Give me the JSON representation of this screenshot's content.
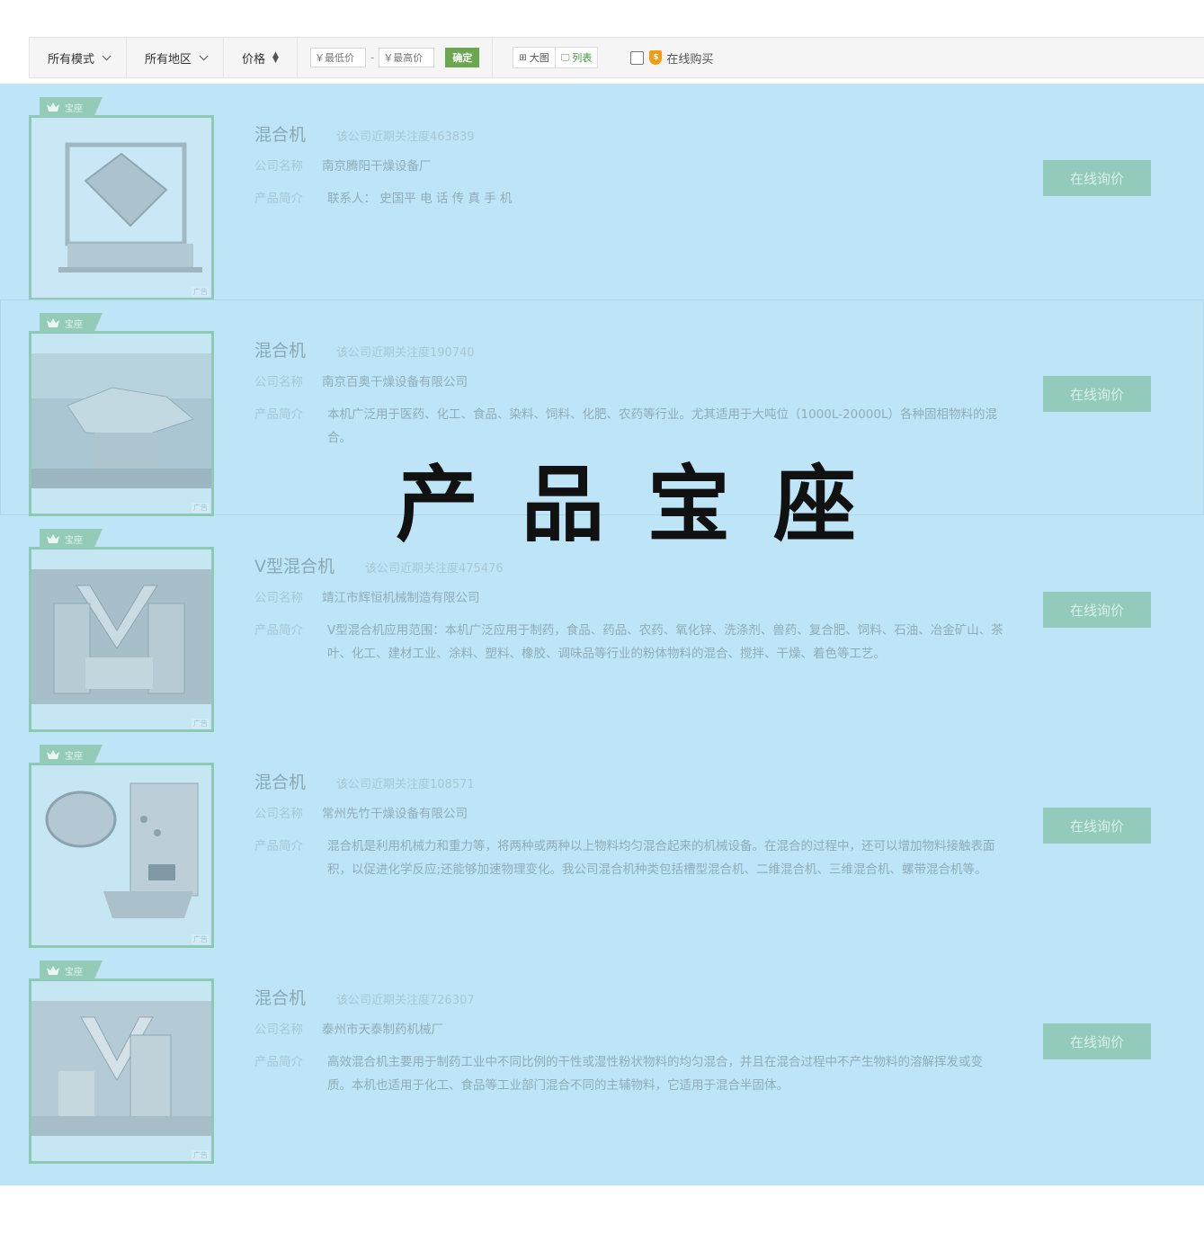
{
  "filter": {
    "mode_label": "所有模式",
    "region_label": "所有地区",
    "price_label": "价格",
    "min_price_placeholder": "￥最低价",
    "max_price_placeholder": "￥最高价",
    "range_separator": "-",
    "confirm_label": "确定",
    "view_large_label": "大图",
    "view_list_label": "列表",
    "online_buy_label": "在线购买",
    "icons": {
      "mode": "chevron-down-icon",
      "region": "chevron-down-icon",
      "price": "sort-icon",
      "large": "grid-icon",
      "list": "monitor-icon",
      "online": "shield-icon"
    }
  },
  "badge_label": "宝座",
  "ad_label": "广告",
  "overlay_title": "产品宝座",
  "labels": {
    "company": "公司名称",
    "intro": "产品简介",
    "inquiry": "在线询价"
  },
  "colors": {
    "list_bg": "#bde4f7",
    "accent_green": "#6aa84f",
    "badge": "#93cbb8"
  },
  "products": [
    {
      "title": "混合机",
      "attention": "该公司近期关注度463839",
      "company": "南京腾阳干燥设备厂",
      "intro": "联系人：  史国平 电 话 传 真 手 机"
    },
    {
      "title": "混合机",
      "attention": "该公司近期关注度190740",
      "company": "南京百奥干燥设备有限公司",
      "intro": "本机广泛用于医药、化工、食品、染料、饲料、化肥、农药等行业。尤其适用于大吨位（1000L-20000L）各种固相物料的混合。"
    },
    {
      "title": "V型混合机",
      "attention": "该公司近期关注度475476",
      "company": "靖江市辉恒机械制造有限公司",
      "intro": "V型混合机应用范围：本机广泛应用于制药，食品、药品、农药、氧化锌、洗涤剂、兽药、复合肥、饲料、石油、冶金矿山、茶叶、化工、建材工业、涂料、塑料、橡胶、调味品等行业的粉体物料的混合、搅拌、干燥、着色等工艺。"
    },
    {
      "title": "混合机",
      "attention": "该公司近期关注度108571",
      "company": "常州先竹干燥设备有限公司",
      "intro": "混合机是利用机械力和重力等，将两种或两种以上物料均匀混合起来的机械设备。在混合的过程中，还可以增加物料接触表面积，以促进化学反应;还能够加速物理变化。我公司混合机种类包括槽型混合机、二维混合机、三维混合机、螺带混合机等。"
    },
    {
      "title": "混合机",
      "attention": "该公司近期关注度726307",
      "company": "泰州市天泰制药机械厂",
      "intro": "高效混合机主要用于制药工业中不同比例的干性或湿性粉状物料的均匀混合，并且在混合过程中不产生物料的溶解挥发或变质。本机也适用于化工、食品等工业部门混合不同的主辅物料，它适用于混合半固体。"
    }
  ]
}
